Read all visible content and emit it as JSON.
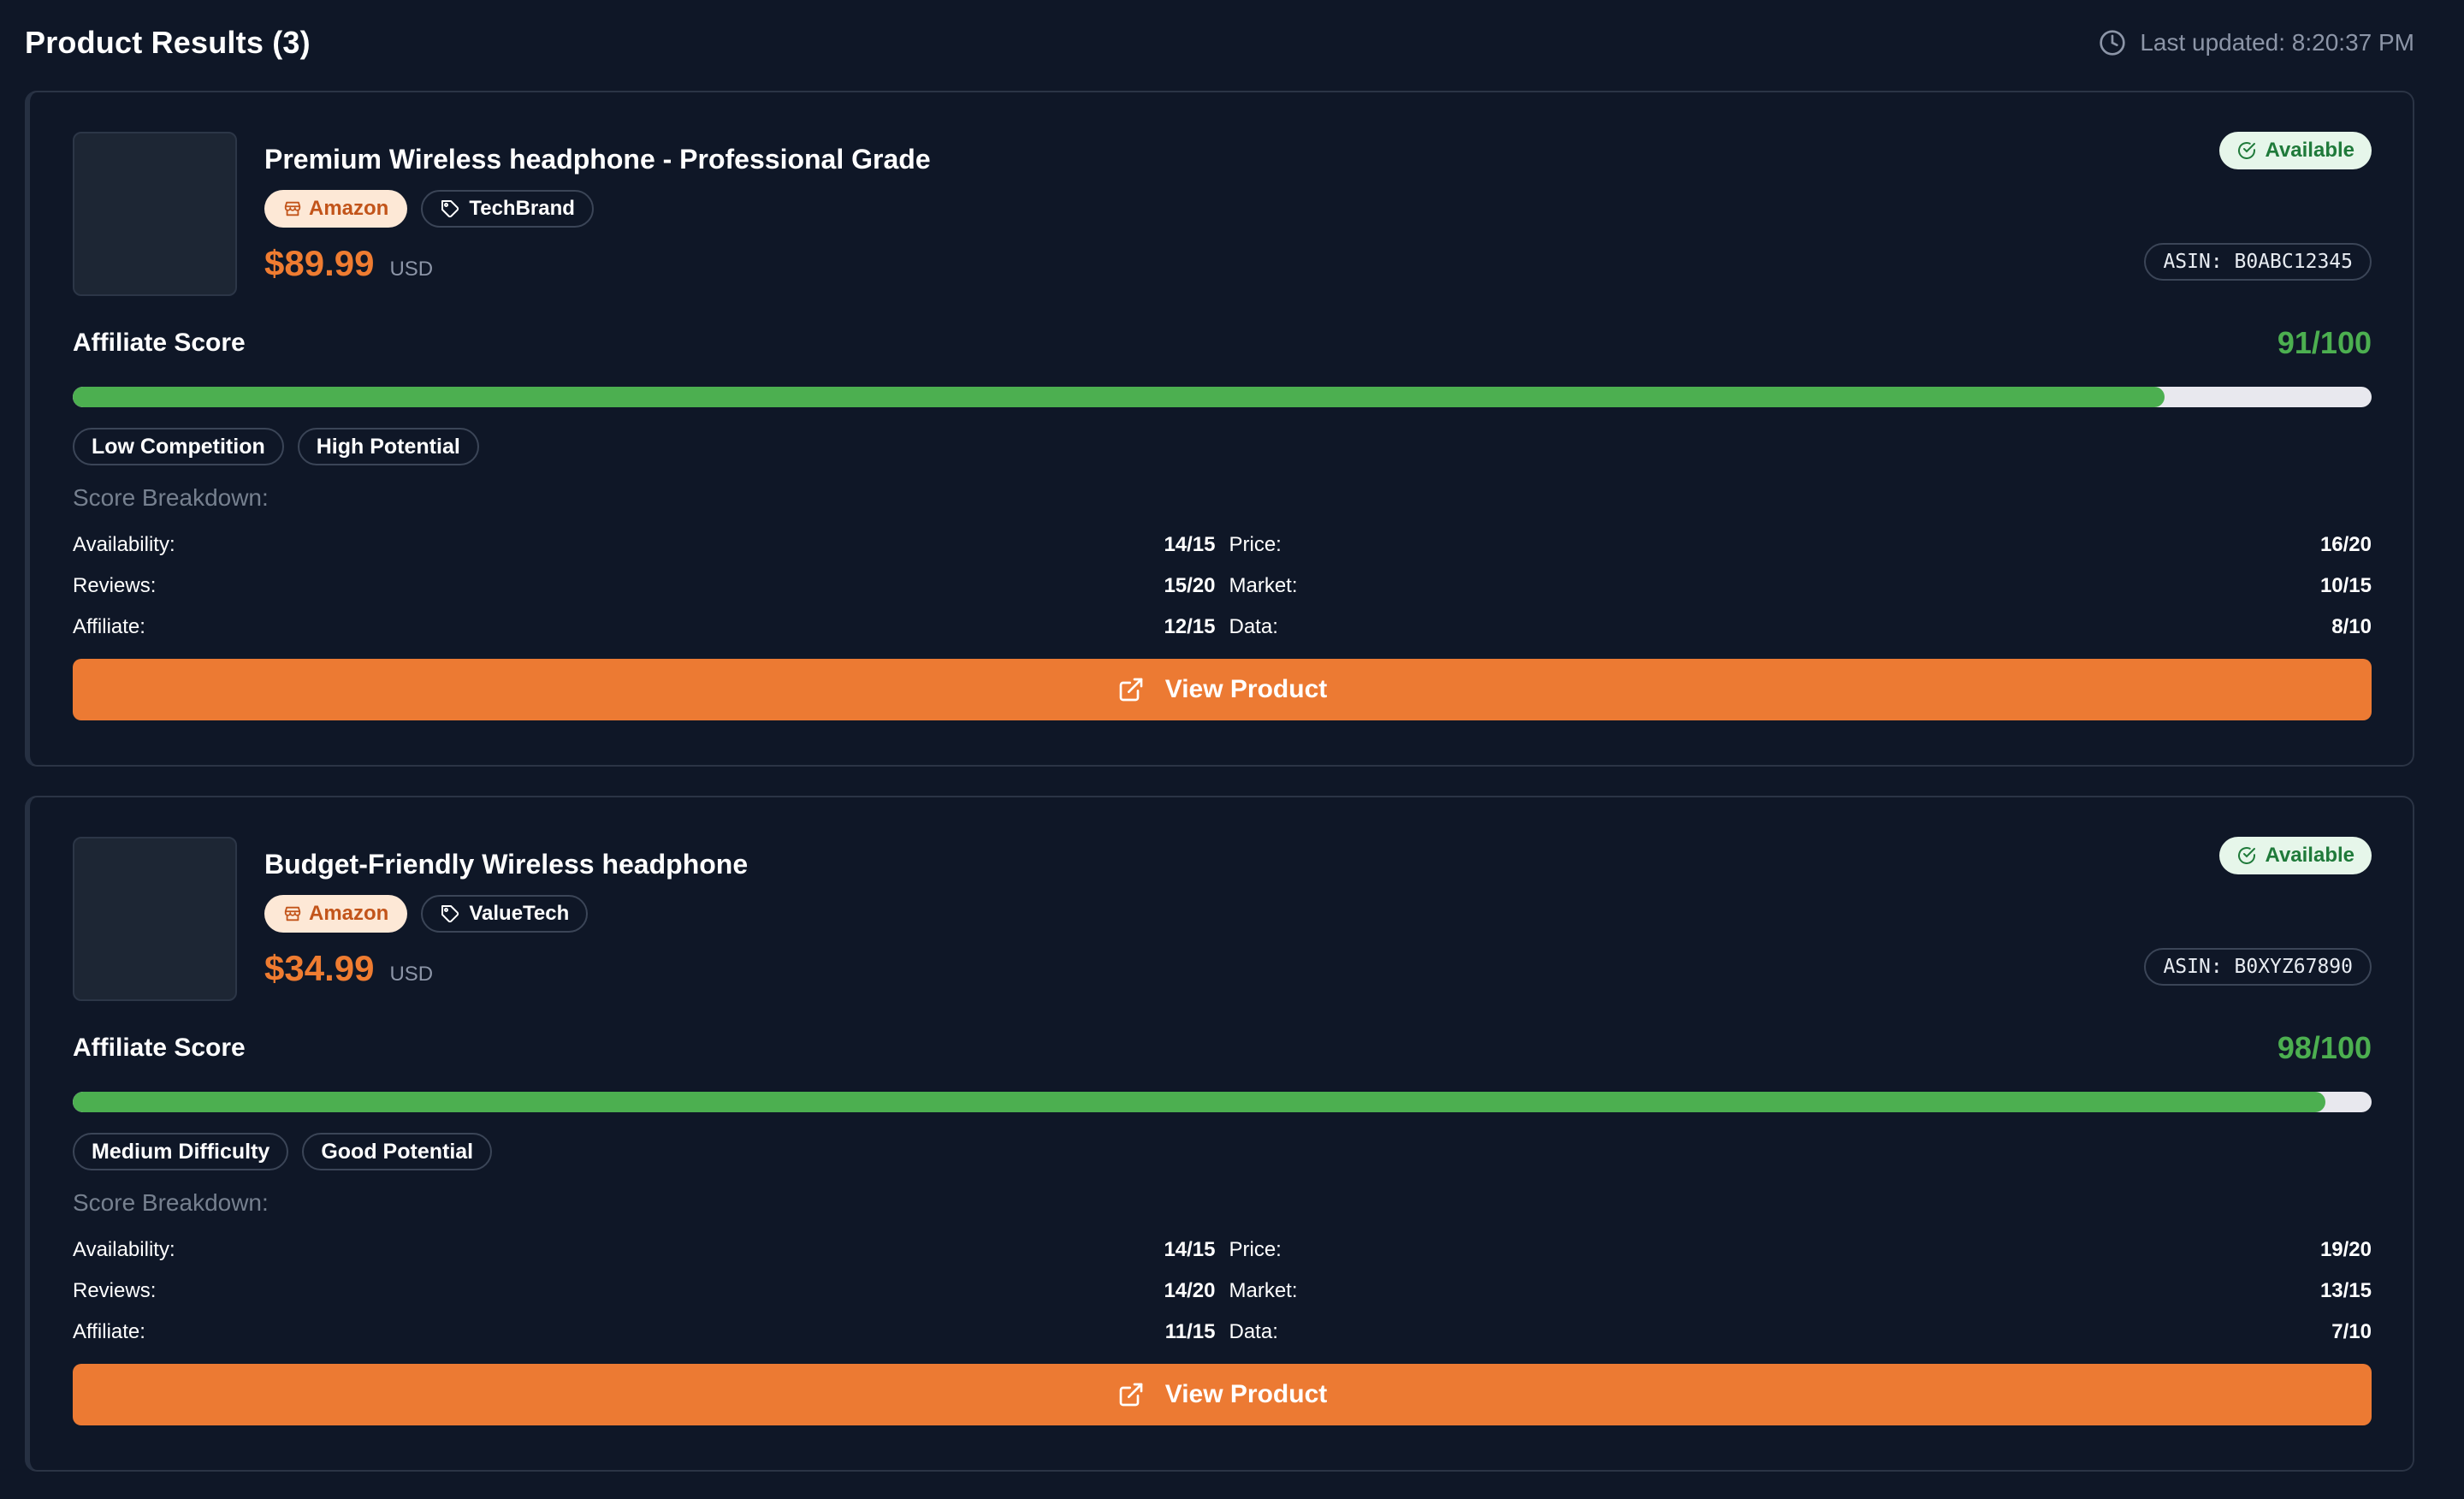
{
  "header": {
    "title": "Product Results (3)",
    "last_updated": "Last updated: 8:20:37 PM"
  },
  "colors": {
    "background": "#0f1727",
    "accent_orange": "#ec7a33",
    "score_green": "#4caf50",
    "available_bg": "#e6f6ea"
  },
  "products": [
    {
      "title": "Premium Wireless headphone - Professional Grade",
      "store": "Amazon",
      "brand": "TechBrand",
      "price": "$89.99",
      "currency": "USD",
      "availability": "Available",
      "asin": "ASIN: B0ABC12345",
      "score_label": "Affiliate Score",
      "score": "91/100",
      "score_fraction": 0.91,
      "tags": [
        "Low Competition",
        "High Potential"
      ],
      "breakdown_title": "Score Breakdown:",
      "breakdown": [
        {
          "label": "Availability:",
          "value": "14/15"
        },
        {
          "label": "Price:",
          "value": "16/20"
        },
        {
          "label": "Reviews:",
          "value": "15/20"
        },
        {
          "label": "Market:",
          "value": "10/15"
        },
        {
          "label": "Affiliate:",
          "value": "12/15"
        },
        {
          "label": "Data:",
          "value": "8/10"
        }
      ],
      "button_label": "View Product"
    },
    {
      "title": "Budget-Friendly Wireless headphone",
      "store": "Amazon",
      "brand": "ValueTech",
      "price": "$34.99",
      "currency": "USD",
      "availability": "Available",
      "asin": "ASIN: B0XYZ67890",
      "score_label": "Affiliate Score",
      "score": "98/100",
      "score_fraction": 0.98,
      "tags": [
        "Medium Difficulty",
        "Good Potential"
      ],
      "breakdown_title": "Score Breakdown:",
      "breakdown": [
        {
          "label": "Availability:",
          "value": "14/15"
        },
        {
          "label": "Price:",
          "value": "19/20"
        },
        {
          "label": "Reviews:",
          "value": "14/20"
        },
        {
          "label": "Market:",
          "value": "13/15"
        },
        {
          "label": "Affiliate:",
          "value": "11/15"
        },
        {
          "label": "Data:",
          "value": "7/10"
        }
      ],
      "button_label": "View Product"
    }
  ]
}
